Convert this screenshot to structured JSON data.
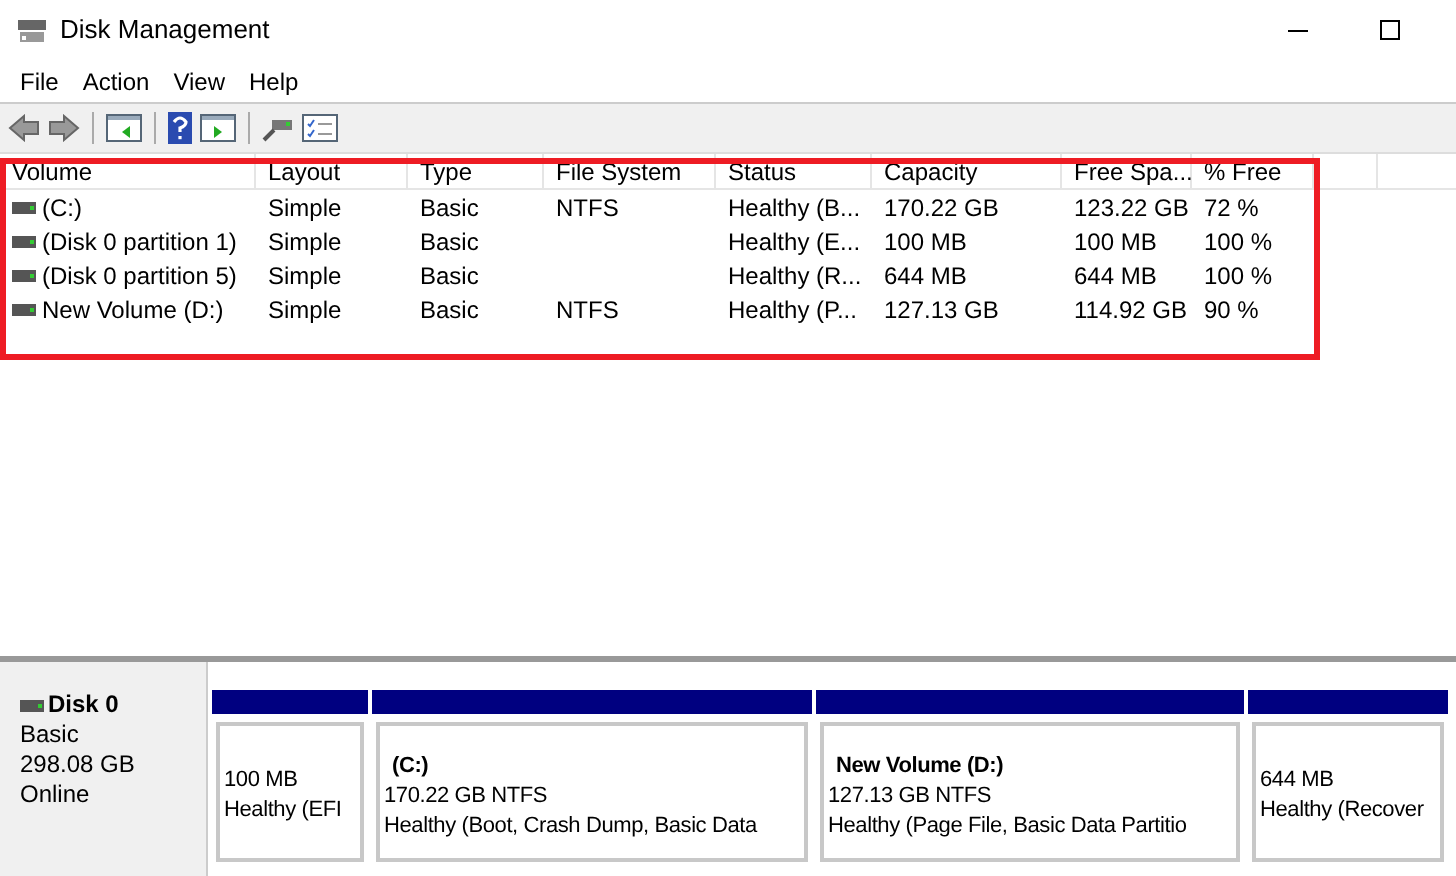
{
  "window": {
    "title": "Disk Management"
  },
  "menu": [
    "File",
    "Action",
    "View",
    "Help"
  ],
  "table": {
    "columns": [
      "Volume",
      "Layout",
      "Type",
      "File System",
      "Status",
      "Capacity",
      "Free Spa...",
      "% Free"
    ],
    "rows": [
      {
        "cells": [
          "(C:)",
          "Simple",
          "Basic",
          "NTFS",
          "Healthy (B...",
          "170.22 GB",
          "123.22 GB",
          "72 %"
        ]
      },
      {
        "cells": [
          "(Disk 0 partition 1)",
          "Simple",
          "Basic",
          null,
          "Healthy (E...",
          "100 MB",
          "100 MB",
          "100 %"
        ]
      },
      {
        "cells": [
          "(Disk 0 partition 5)",
          "Simple",
          "Basic",
          null,
          "Healthy (R...",
          "644 MB",
          "644 MB",
          "100 %"
        ]
      },
      {
        "cells": [
          "New Volume (D:)",
          "Simple",
          "Basic",
          "NTFS",
          "Healthy (P...",
          "127.13 GB",
          "114.92 GB",
          "90 %"
        ]
      }
    ]
  },
  "disk": {
    "name": "Disk 0",
    "type": "Basic",
    "size": "298.08 GB",
    "status": "Online",
    "partitions": [
      {
        "size": "100 MB",
        "status": "Healthy (EFI"
      },
      {
        "name": "(C:)",
        "size": "170.22 GB NTFS",
        "status": "Healthy (Boot, Crash Dump, Basic Data"
      },
      {
        "name": "New Volume  (D:)",
        "size": "127.13 GB NTFS",
        "status": "Healthy (Page File, Basic Data Partitio"
      },
      {
        "size": "644 MB",
        "status": "Healthy (Recover"
      }
    ]
  }
}
